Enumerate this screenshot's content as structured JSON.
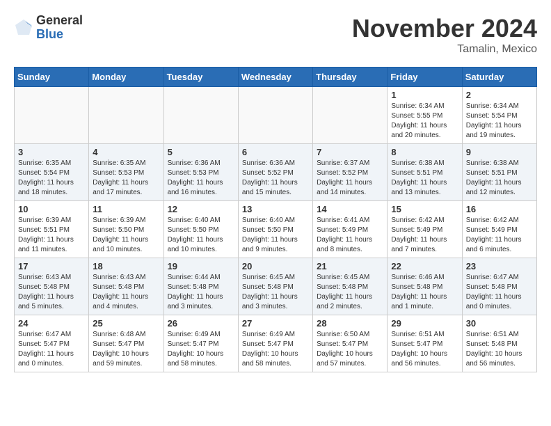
{
  "logo": {
    "general": "General",
    "blue": "Blue"
  },
  "title": "November 2024",
  "location": "Tamalin, Mexico",
  "days_header": [
    "Sunday",
    "Monday",
    "Tuesday",
    "Wednesday",
    "Thursday",
    "Friday",
    "Saturday"
  ],
  "weeks": [
    [
      {
        "day": "",
        "info": ""
      },
      {
        "day": "",
        "info": ""
      },
      {
        "day": "",
        "info": ""
      },
      {
        "day": "",
        "info": ""
      },
      {
        "day": "",
        "info": ""
      },
      {
        "day": "1",
        "info": "Sunrise: 6:34 AM\nSunset: 5:55 PM\nDaylight: 11 hours and 20 minutes."
      },
      {
        "day": "2",
        "info": "Sunrise: 6:34 AM\nSunset: 5:54 PM\nDaylight: 11 hours and 19 minutes."
      }
    ],
    [
      {
        "day": "3",
        "info": "Sunrise: 6:35 AM\nSunset: 5:54 PM\nDaylight: 11 hours and 18 minutes."
      },
      {
        "day": "4",
        "info": "Sunrise: 6:35 AM\nSunset: 5:53 PM\nDaylight: 11 hours and 17 minutes."
      },
      {
        "day": "5",
        "info": "Sunrise: 6:36 AM\nSunset: 5:53 PM\nDaylight: 11 hours and 16 minutes."
      },
      {
        "day": "6",
        "info": "Sunrise: 6:36 AM\nSunset: 5:52 PM\nDaylight: 11 hours and 15 minutes."
      },
      {
        "day": "7",
        "info": "Sunrise: 6:37 AM\nSunset: 5:52 PM\nDaylight: 11 hours and 14 minutes."
      },
      {
        "day": "8",
        "info": "Sunrise: 6:38 AM\nSunset: 5:51 PM\nDaylight: 11 hours and 13 minutes."
      },
      {
        "day": "9",
        "info": "Sunrise: 6:38 AM\nSunset: 5:51 PM\nDaylight: 11 hours and 12 minutes."
      }
    ],
    [
      {
        "day": "10",
        "info": "Sunrise: 6:39 AM\nSunset: 5:51 PM\nDaylight: 11 hours and 11 minutes."
      },
      {
        "day": "11",
        "info": "Sunrise: 6:39 AM\nSunset: 5:50 PM\nDaylight: 11 hours and 10 minutes."
      },
      {
        "day": "12",
        "info": "Sunrise: 6:40 AM\nSunset: 5:50 PM\nDaylight: 11 hours and 10 minutes."
      },
      {
        "day": "13",
        "info": "Sunrise: 6:40 AM\nSunset: 5:50 PM\nDaylight: 11 hours and 9 minutes."
      },
      {
        "day": "14",
        "info": "Sunrise: 6:41 AM\nSunset: 5:49 PM\nDaylight: 11 hours and 8 minutes."
      },
      {
        "day": "15",
        "info": "Sunrise: 6:42 AM\nSunset: 5:49 PM\nDaylight: 11 hours and 7 minutes."
      },
      {
        "day": "16",
        "info": "Sunrise: 6:42 AM\nSunset: 5:49 PM\nDaylight: 11 hours and 6 minutes."
      }
    ],
    [
      {
        "day": "17",
        "info": "Sunrise: 6:43 AM\nSunset: 5:48 PM\nDaylight: 11 hours and 5 minutes."
      },
      {
        "day": "18",
        "info": "Sunrise: 6:43 AM\nSunset: 5:48 PM\nDaylight: 11 hours and 4 minutes."
      },
      {
        "day": "19",
        "info": "Sunrise: 6:44 AM\nSunset: 5:48 PM\nDaylight: 11 hours and 3 minutes."
      },
      {
        "day": "20",
        "info": "Sunrise: 6:45 AM\nSunset: 5:48 PM\nDaylight: 11 hours and 3 minutes."
      },
      {
        "day": "21",
        "info": "Sunrise: 6:45 AM\nSunset: 5:48 PM\nDaylight: 11 hours and 2 minutes."
      },
      {
        "day": "22",
        "info": "Sunrise: 6:46 AM\nSunset: 5:48 PM\nDaylight: 11 hours and 1 minute."
      },
      {
        "day": "23",
        "info": "Sunrise: 6:47 AM\nSunset: 5:48 PM\nDaylight: 11 hours and 0 minutes."
      }
    ],
    [
      {
        "day": "24",
        "info": "Sunrise: 6:47 AM\nSunset: 5:47 PM\nDaylight: 11 hours and 0 minutes."
      },
      {
        "day": "25",
        "info": "Sunrise: 6:48 AM\nSunset: 5:47 PM\nDaylight: 10 hours and 59 minutes."
      },
      {
        "day": "26",
        "info": "Sunrise: 6:49 AM\nSunset: 5:47 PM\nDaylight: 10 hours and 58 minutes."
      },
      {
        "day": "27",
        "info": "Sunrise: 6:49 AM\nSunset: 5:47 PM\nDaylight: 10 hours and 58 minutes."
      },
      {
        "day": "28",
        "info": "Sunrise: 6:50 AM\nSunset: 5:47 PM\nDaylight: 10 hours and 57 minutes."
      },
      {
        "day": "29",
        "info": "Sunrise: 6:51 AM\nSunset: 5:47 PM\nDaylight: 10 hours and 56 minutes."
      },
      {
        "day": "30",
        "info": "Sunrise: 6:51 AM\nSunset: 5:48 PM\nDaylight: 10 hours and 56 minutes."
      }
    ]
  ]
}
